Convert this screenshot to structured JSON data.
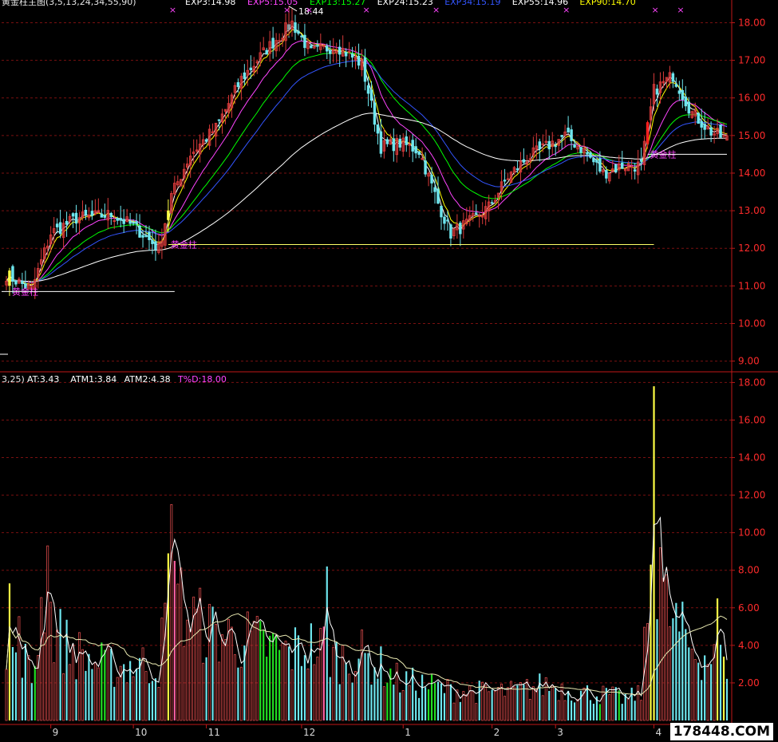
{
  "watermark": "178448.COM",
  "colors": {
    "background": "#000000",
    "grid": "#7a1010",
    "axis_labels": "#ff2b2b",
    "up_candle": "#d83a3a",
    "down_candle": "#6ee6ee",
    "up_atr": "#d84a4a",
    "down_atr": "#6ee6ee",
    "green_atr": "#22dd22",
    "yellow": "#ffff44",
    "pink": "#ff5fa0",
    "ema": [
      "#ffffff",
      "#ffff00",
      "#ff44ff",
      "#00ff00",
      "#3355ff",
      "#ffffff"
    ]
  },
  "chart_data": [
    {
      "type": "candlestick",
      "title": "黄金柱主图(3,5,13,24,34,55,90)",
      "legend": [
        {
          "label": "EXP3:14.98",
          "color": "#ffffff"
        },
        {
          "label": "EXP5:15.05",
          "color": "#ff44ff"
        },
        {
          "label": "EXP13:15.27",
          "color": "#00ff00"
        },
        {
          "label": "EXP24:15.23",
          "color": "#ffffff"
        },
        {
          "label": "EXP34:15.19",
          "color": "#3355ff"
        },
        {
          "label": "EXP55:14.96",
          "color": "#ffffff"
        },
        {
          "label": "EXP90:14.70",
          "color": "#ffff00"
        }
      ],
      "ylim": [
        8.8,
        18.35
      ],
      "yticks": [
        9.0,
        10.0,
        11.0,
        12.0,
        13.0,
        14.0,
        15.0,
        16.0,
        17.0,
        18.0
      ],
      "close_anchors": [
        [
          0,
          11.3
        ],
        [
          8,
          10.9
        ],
        [
          14,
          12.4
        ],
        [
          22,
          12.8
        ],
        [
          33,
          12.9
        ],
        [
          40,
          12.6
        ],
        [
          48,
          12.0
        ],
        [
          52,
          13.4
        ],
        [
          58,
          14.5
        ],
        [
          66,
          15.2
        ],
        [
          74,
          16.5
        ],
        [
          82,
          17.3
        ],
        [
          90,
          18.0
        ],
        [
          96,
          17.2
        ],
        [
          104,
          17.4
        ],
        [
          112,
          16.9
        ],
        [
          118,
          14.7
        ],
        [
          124,
          14.8
        ],
        [
          130,
          14.6
        ],
        [
          136,
          13.2
        ],
        [
          140,
          12.4
        ],
        [
          146,
          12.7
        ],
        [
          152,
          13.1
        ],
        [
          158,
          13.9
        ],
        [
          164,
          14.4
        ],
        [
          170,
          14.7
        ],
        [
          176,
          15.0
        ],
        [
          182,
          14.6
        ],
        [
          188,
          14.0
        ],
        [
          194,
          14.2
        ],
        [
          200,
          14.2
        ],
        [
          204,
          16.2
        ],
        [
          210,
          16.6
        ],
        [
          216,
          15.6
        ],
        [
          222,
          15.1
        ],
        [
          227,
          14.9
        ]
      ],
      "max_annotation": {
        "label": "18.44",
        "bar": 89,
        "value": 18.44
      },
      "golden_pillars": [
        {
          "bar": 1,
          "label": "黄金柱",
          "level": 10.85,
          "end_bar": 53
        },
        {
          "bar": 51,
          "label": "黄金柱",
          "level": 12.1,
          "end_bar": 53
        },
        {
          "bar": 202,
          "label": "黄金柱",
          "level": 14.5,
          "end_bar": 227
        }
      ],
      "support_line": {
        "level": 12.1,
        "from_bar": 51,
        "to_bar": 204
      },
      "markers": {
        "symbol": "×",
        "bars": [
          52,
          88,
          95,
          113,
          135,
          176,
          204,
          212
        ]
      }
    },
    {
      "type": "bar",
      "title": "3,25)",
      "legend": [
        {
          "label": "AT:3.43",
          "color": "#ffffff"
        },
        {
          "label": "ATM1:3.84",
          "color": "#ffffff"
        },
        {
          "label": "ATM2:4.38",
          "color": "#ffffff"
        },
        {
          "label": "T%D:18.00",
          "color": "#ff44ff"
        }
      ],
      "ylim": [
        0,
        18.4
      ],
      "yticks": [
        2.0,
        4.0,
        6.0,
        8.0,
        10.0,
        12.0,
        14.0,
        16.0,
        18.0
      ],
      "atr_anchors": [
        [
          0,
          3.0
        ],
        [
          4,
          4.5
        ],
        [
          8,
          2.2
        ],
        [
          12,
          7.5
        ],
        [
          15,
          5.0
        ],
        [
          20,
          4.0
        ],
        [
          28,
          3.2
        ],
        [
          35,
          3.0
        ],
        [
          42,
          3.2
        ],
        [
          48,
          3.0
        ],
        [
          52,
          8.0
        ],
        [
          56,
          6.0
        ],
        [
          64,
          5.0
        ],
        [
          72,
          4.6
        ],
        [
          80,
          4.3
        ],
        [
          88,
          3.8
        ],
        [
          96,
          4.2
        ],
        [
          104,
          3.5
        ],
        [
          112,
          3.6
        ],
        [
          118,
          3.0
        ],
        [
          124,
          2.2
        ],
        [
          132,
          2.0
        ],
        [
          140,
          1.7
        ],
        [
          150,
          1.6
        ],
        [
          160,
          1.6
        ],
        [
          170,
          2.0
        ],
        [
          180,
          1.6
        ],
        [
          190,
          1.4
        ],
        [
          196,
          1.2
        ],
        [
          200,
          1.6
        ],
        [
          203,
          8.0
        ],
        [
          206,
          7.0
        ],
        [
          210,
          5.5
        ],
        [
          216,
          4.0
        ],
        [
          222,
          3.5
        ],
        [
          227,
          3.0
        ]
      ],
      "spikes": [
        {
          "bar": 1,
          "value": 7.3,
          "color": "yellow"
        },
        {
          "bar": 13,
          "value": 9.3,
          "color": "up"
        },
        {
          "bar": 51,
          "value": 8.9,
          "color": "yellow"
        },
        {
          "bar": 52,
          "value": 11.5,
          "color": "up"
        },
        {
          "bar": 53,
          "value": 8.5,
          "color": "pink"
        },
        {
          "bar": 101,
          "value": 8.2,
          "color": "down"
        },
        {
          "bar": 100,
          "value": 5.0,
          "color": "pink"
        },
        {
          "bar": 203,
          "value": 8.3,
          "color": "yellow"
        },
        {
          "bar": 204,
          "value": 17.8,
          "color": "yellow"
        },
        {
          "bar": 206,
          "value": 9.2,
          "color": "up"
        },
        {
          "bar": 224,
          "value": 6.5,
          "color": "yellow"
        },
        {
          "bar": 226,
          "value": 3.4,
          "color": "yellow"
        }
      ],
      "green_bars": [
        9,
        30,
        31,
        80,
        81,
        82,
        83,
        84,
        85,
        86,
        120,
        121,
        133,
        134,
        135,
        187,
        193
      ]
    }
  ],
  "x_axis": {
    "total_bars": 228,
    "ticks": [
      {
        "label": "9",
        "bar": 14
      },
      {
        "label": "10",
        "bar": 40
      },
      {
        "label": "11",
        "bar": 63
      },
      {
        "label": "12",
        "bar": 93
      },
      {
        "label": "1",
        "bar": 125
      },
      {
        "label": "2",
        "bar": 153
      },
      {
        "label": "3",
        "bar": 173
      },
      {
        "label": "4",
        "bar": 204
      }
    ]
  }
}
